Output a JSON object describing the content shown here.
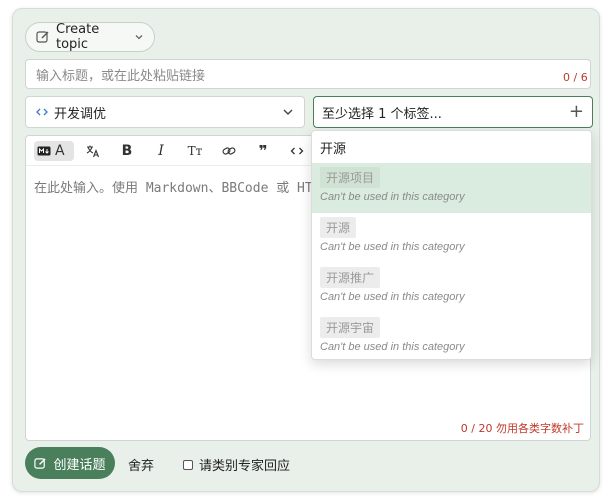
{
  "composer": {
    "create_topic_label": "Create topic",
    "title_placeholder": "输入标题，或在此处粘贴链接",
    "title_count": "0 / 6",
    "category": {
      "label": "开发调优",
      "icon": "code-icon"
    },
    "tags_placeholder": "至少选择 1 个标签...",
    "editor": {
      "placeholder": "在此处输入。使用 Markdown、BBCode 或 HTML",
      "body_hint": "0 / 20 勿用各类字数补丁"
    }
  },
  "toolbar": {
    "buttons": [
      "translate",
      "bold",
      "italic",
      "heading",
      "link",
      "quote",
      "code"
    ],
    "heading_glyph": "Tт"
  },
  "tag_dropdown": {
    "filter": "开源",
    "items": [
      {
        "tag": "开源项目",
        "note": "Can't be used in this category",
        "active": true
      },
      {
        "tag": "开源",
        "note": "Can't be used in this category",
        "active": false
      },
      {
        "tag": "开源推广",
        "note": "Can't be used in this category",
        "active": false
      },
      {
        "tag": "开源宇宙",
        "note": "Can't be used in this category",
        "active": false
      }
    ]
  },
  "footer": {
    "submit_label": "创建话题",
    "discard_label": "舍弃",
    "expert_label": "请类别专家回应"
  },
  "colors": {
    "accent": "#4a7f5c",
    "error": "#c0392b",
    "panel": "#e9f0ea"
  }
}
